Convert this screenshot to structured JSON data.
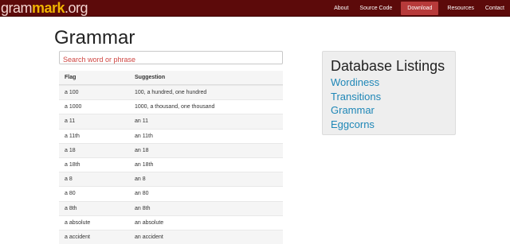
{
  "nav": {
    "brand_pre": "gram",
    "brand_mark": "mark",
    "brand_post": ".org",
    "items": [
      {
        "label": "About"
      },
      {
        "label": "Source Code"
      },
      {
        "label": "Download"
      },
      {
        "label": "Resources"
      },
      {
        "label": "Contact"
      }
    ],
    "active_item": "Download",
    "background": "#5c0a0a",
    "active_color": "#b73a3a",
    "brand_mark_color": "#f0b400"
  },
  "page": {
    "title": "Grammar",
    "search_placeholder": "Search word or phrase"
  },
  "table": {
    "headers": {
      "flag": "Flag",
      "suggestion": "Suggestion"
    },
    "rows": [
      {
        "flag": "a 100",
        "suggestion": "100, a hundred, one hundred"
      },
      {
        "flag": "a 1000",
        "suggestion": "1000, a thousand, one thousand"
      },
      {
        "flag": "a 11",
        "suggestion": "an 11"
      },
      {
        "flag": "a 11th",
        "suggestion": "an 11th"
      },
      {
        "flag": "a 18",
        "suggestion": "an 18"
      },
      {
        "flag": "a 18th",
        "suggestion": "an 18th"
      },
      {
        "flag": "a 8",
        "suggestion": "an 8"
      },
      {
        "flag": "a 80",
        "suggestion": "an 80"
      },
      {
        "flag": "a 8th",
        "suggestion": "an 8th"
      },
      {
        "flag": "a absolute",
        "suggestion": "an absolute"
      },
      {
        "flag": "a accident",
        "suggestion": "an accident"
      }
    ]
  },
  "sidebar": {
    "title": "Database Listings",
    "links": [
      {
        "label": "Wordiness"
      },
      {
        "label": "Transitions"
      },
      {
        "label": "Grammar"
      },
      {
        "label": "Eggcorns"
      }
    ],
    "link_color": "#1f87b7"
  }
}
